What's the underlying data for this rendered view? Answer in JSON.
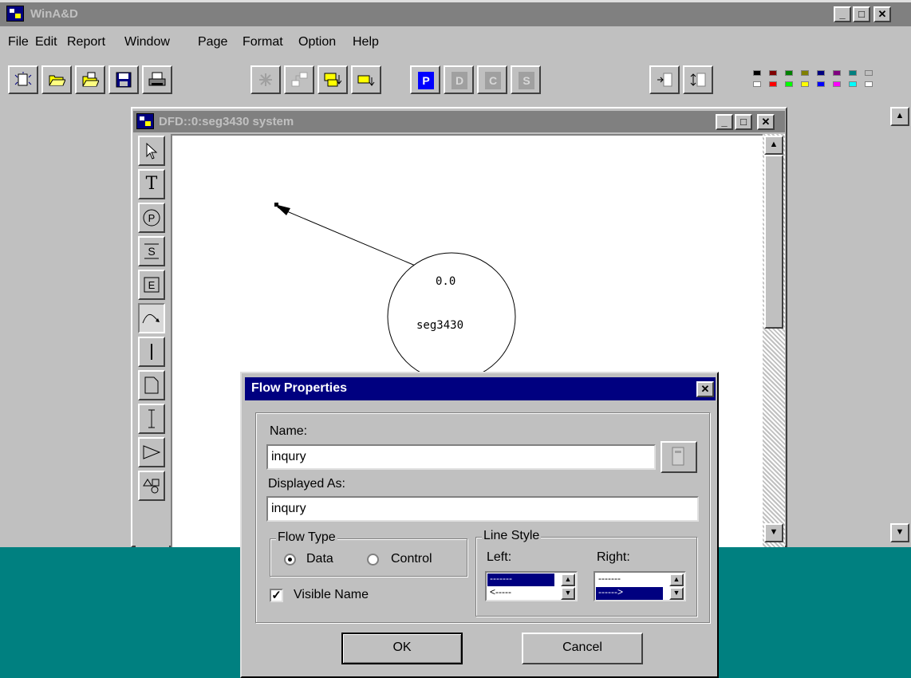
{
  "app": {
    "title": "WinA&D",
    "window_controls": {
      "minimize": "_",
      "maximize": "□",
      "close": "✕"
    }
  },
  "menu": [
    "File",
    "Edit",
    "Report",
    "Window",
    "Page",
    "Format",
    "Option",
    "Help"
  ],
  "toolbar": {
    "letter_buttons": [
      "P",
      "D",
      "C",
      "S"
    ],
    "palette_colors": [
      "#000000",
      "#800000",
      "#008000",
      "#808000",
      "#000080",
      "#800080",
      "#008080",
      "#c0c0c0",
      "#ffffff",
      "#ff0000",
      "#00ff00",
      "#ffff00",
      "#0000ff",
      "#ff00ff",
      "#00ffff",
      "#ffffff"
    ]
  },
  "child_window": {
    "title": "DFD::0:seg3430 system",
    "controls": {
      "minimize": "_",
      "maximize": "□",
      "close": "✕"
    }
  },
  "toolbox": {
    "tools": [
      "pointer-tool",
      "text-tool",
      "process-tool",
      "store-tool",
      "external-tool",
      "flow-tool",
      "line-tool",
      "document-tool",
      "io-tool",
      "triangle-tool",
      "shapes-tool"
    ]
  },
  "diagram": {
    "process_number": "0.0",
    "process_name": "seg3430"
  },
  "dialog": {
    "title": "Flow Properties",
    "close": "✕",
    "name_label": "Name:",
    "name_value": "inqury",
    "displayed_as_label": "Displayed As:",
    "displayed_as_value": "inqury",
    "flow_type": {
      "legend": "Flow Type",
      "options": [
        "Data",
        "Control"
      ],
      "selected": "Data"
    },
    "visible_name": {
      "label": "Visible Name",
      "checked": true
    },
    "line_style": {
      "legend": "Line Style",
      "left_label": "Left:",
      "left_items": [
        "-------",
        "<-----"
      ],
      "left_selected": 0,
      "right_label": "Right:",
      "right_items": [
        "-------",
        "------>"
      ],
      "right_selected": 1
    },
    "ok": "OK",
    "cancel": "Cancel"
  }
}
